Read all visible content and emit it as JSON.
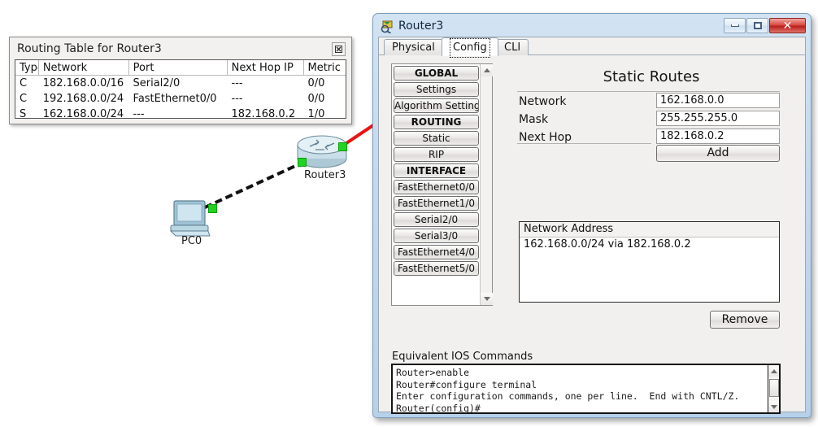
{
  "routing_table": {
    "title": "Routing Table for Router3",
    "close_icon": "close-icon",
    "columns": [
      "Type",
      "Network",
      "Port",
      "Next Hop IP",
      "Metric"
    ],
    "rows": [
      {
        "type": "C",
        "network": "182.168.0.0/16",
        "port": "Serial2/0",
        "next_hop": "---",
        "metric": "0/0"
      },
      {
        "type": "C",
        "network": "192.168.0.0/24",
        "port": "FastEthernet0/0",
        "next_hop": "---",
        "metric": "0/0"
      },
      {
        "type": "S",
        "network": "162.168.0.0/24",
        "port": "---",
        "next_hop": "182.168.0.2",
        "metric": "1/0"
      }
    ]
  },
  "topology": {
    "router_label": "Router3",
    "pc_label": "PC0",
    "link_dot_color": "#21d421",
    "copper_link_color": "#111111",
    "serial_link_color": "#ee1111"
  },
  "window": {
    "title": "Router3",
    "icon": "packet-tracer-device-icon",
    "minimize_label": "minimize-icon",
    "maximize_label": "maximize-icon",
    "close_label": "✕",
    "tabs": [
      {
        "label": "Physical",
        "selected": false
      },
      {
        "label": "Config",
        "selected": true
      },
      {
        "label": "CLI",
        "selected": false
      }
    ]
  },
  "sidebar": {
    "items": [
      {
        "label": "GLOBAL",
        "header": true
      },
      {
        "label": "Settings",
        "header": false
      },
      {
        "label": "Algorithm Settings",
        "header": false
      },
      {
        "label": "ROUTING",
        "header": true
      },
      {
        "label": "Static",
        "header": false
      },
      {
        "label": "RIP",
        "header": false
      },
      {
        "label": "INTERFACE",
        "header": true
      },
      {
        "label": "FastEthernet0/0",
        "header": false
      },
      {
        "label": "FastEthernet1/0",
        "header": false
      },
      {
        "label": "Serial2/0",
        "header": false
      },
      {
        "label": "Serial3/0",
        "header": false
      },
      {
        "label": "FastEthernet4/0",
        "header": false
      },
      {
        "label": "FastEthernet5/0",
        "header": false
      }
    ],
    "scroll_up_icon": "chevron-up-icon",
    "scroll_down_icon": "chevron-down-icon"
  },
  "static_routes": {
    "heading": "Static Routes",
    "fields": [
      {
        "label": "Network",
        "value": "162.168.0.0"
      },
      {
        "label": "Mask",
        "value": "255.255.255.0"
      },
      {
        "label": "Next Hop",
        "value": "182.168.0.2"
      }
    ],
    "add_label": "Add",
    "list_header": "Network Address",
    "list_items": [
      "162.168.0.0/24 via 182.168.0.2"
    ],
    "remove_label": "Remove"
  },
  "ios": {
    "label": "Equivalent IOS Commands",
    "lines": "Router>enable\nRouter#configure terminal\nEnter configuration commands, one per line.  End with CNTL/Z.\nRouter(config)#"
  }
}
